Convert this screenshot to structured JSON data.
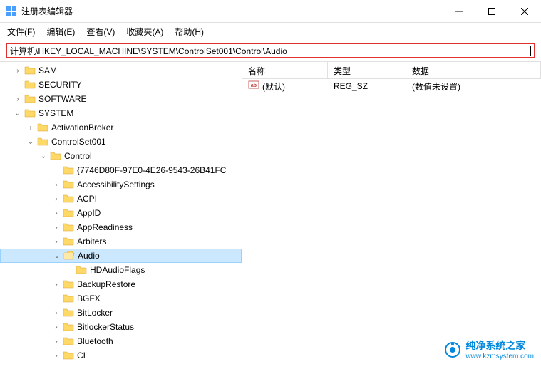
{
  "window": {
    "title": "注册表编辑器"
  },
  "menu": {
    "file": "文件(F)",
    "edit": "编辑(E)",
    "view": "查看(V)",
    "favorites": "收藏夹(A)",
    "help": "帮助(H)"
  },
  "addressbar": {
    "path": "计算机\\HKEY_LOCAL_MACHINE\\SYSTEM\\ControlSet001\\Control\\Audio"
  },
  "tree": [
    {
      "indent": 1,
      "expander": "›",
      "label": "SAM"
    },
    {
      "indent": 1,
      "expander": "",
      "label": "SECURITY"
    },
    {
      "indent": 1,
      "expander": "›",
      "label": "SOFTWARE"
    },
    {
      "indent": 1,
      "expander": "⌄",
      "label": "SYSTEM"
    },
    {
      "indent": 2,
      "expander": "›",
      "label": "ActivationBroker"
    },
    {
      "indent": 2,
      "expander": "⌄",
      "label": "ControlSet001"
    },
    {
      "indent": 3,
      "expander": "⌄",
      "label": "Control"
    },
    {
      "indent": 4,
      "expander": "",
      "label": "{7746D80F-97E0-4E26-9543-26B41FC"
    },
    {
      "indent": 4,
      "expander": "›",
      "label": "AccessibilitySettings"
    },
    {
      "indent": 4,
      "expander": "›",
      "label": "ACPI"
    },
    {
      "indent": 4,
      "expander": "›",
      "label": "AppID"
    },
    {
      "indent": 4,
      "expander": "›",
      "label": "AppReadiness"
    },
    {
      "indent": 4,
      "expander": "›",
      "label": "Arbiters"
    },
    {
      "indent": 4,
      "expander": "⌄",
      "label": "Audio",
      "selected": true,
      "open": true
    },
    {
      "indent": 5,
      "expander": "",
      "label": "HDAudioFlags"
    },
    {
      "indent": 4,
      "expander": "›",
      "label": "BackupRestore"
    },
    {
      "indent": 4,
      "expander": "",
      "label": "BGFX"
    },
    {
      "indent": 4,
      "expander": "›",
      "label": "BitLocker"
    },
    {
      "indent": 4,
      "expander": "›",
      "label": "BitlockerStatus"
    },
    {
      "indent": 4,
      "expander": "›",
      "label": "Bluetooth"
    },
    {
      "indent": 4,
      "expander": "›",
      "label": "CI"
    }
  ],
  "list": {
    "headers": {
      "name": "名称",
      "type": "类型",
      "data": "数据"
    },
    "rows": [
      {
        "name": "(默认)",
        "type": "REG_SZ",
        "data": "(数值未设置)"
      }
    ]
  },
  "watermark": {
    "brand": "纯净系统之家",
    "url": "www.kzmsystem.com"
  }
}
